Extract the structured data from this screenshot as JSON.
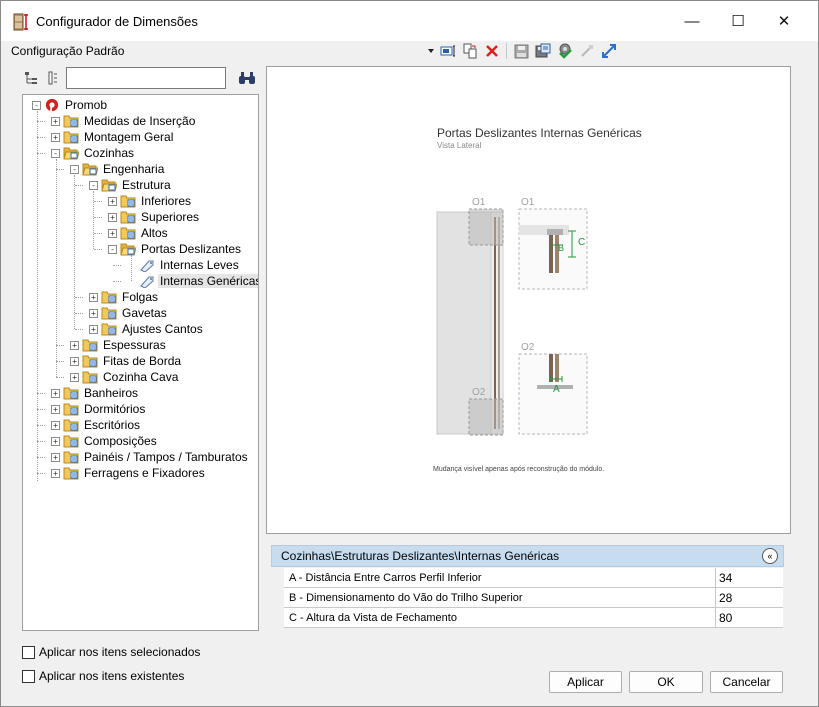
{
  "window": {
    "title": "Configurador de Dimensões",
    "minimize": "—",
    "maximize": "☐",
    "close": "✕"
  },
  "config": {
    "label": "Configuração Padrão"
  },
  "toolbar": {
    "icons": [
      "dropdown-arrow-icon",
      "text-field-icon",
      "copy-icon",
      "delete-icon",
      "save-icon",
      "save-as-icon",
      "settings-check-icon",
      "collapse-icon",
      "expand-icon"
    ]
  },
  "search": {
    "value": "",
    "placeholder": ""
  },
  "tree": {
    "root": "Promob",
    "items": [
      {
        "label": "Medidas de Inserção"
      },
      {
        "label": "Montagem Geral"
      },
      {
        "label": "Cozinhas"
      },
      {
        "label": "Engenharia"
      },
      {
        "label": "Estrutura"
      },
      {
        "label": "Inferiores"
      },
      {
        "label": "Superiores"
      },
      {
        "label": "Altos"
      },
      {
        "label": "Portas Deslizantes"
      },
      {
        "label": "Internas Leves"
      },
      {
        "label": "Internas Genéricas"
      },
      {
        "label": "Folgas"
      },
      {
        "label": "Gavetas"
      },
      {
        "label": "Ajustes Cantos"
      },
      {
        "label": "Espessuras"
      },
      {
        "label": "Fitas de Borda"
      },
      {
        "label": "Cozinha Cava"
      },
      {
        "label": "Banheiros"
      },
      {
        "label": "Dormitórios"
      },
      {
        "label": "Escritórios"
      },
      {
        "label": "Composições"
      },
      {
        "label": "Painéis / Tampos / Tamburatos"
      },
      {
        "label": "Ferragens e Fixadores"
      }
    ]
  },
  "preview": {
    "title": "Portas Deslizantes Internas Genéricas",
    "subtitle": "Vista Lateral",
    "labels": {
      "o1a": "O1",
      "o1b": "O1",
      "o2a": "O2",
      "o2b": "O2",
      "a": "A",
      "b": "B",
      "c": "C"
    },
    "note": "Mudança visível apenas após reconstrução do módulo."
  },
  "properties": {
    "path": "Cozinhas\\Estruturas Deslizantes\\Internas Genéricas",
    "collapse": "«",
    "rows": [
      {
        "name": "A - Distância Entre Carros Perfil Inferior",
        "value": "34"
      },
      {
        "name": "B - Dimensionamento do Vão do Trilho Superior",
        "value": "28"
      },
      {
        "name": "C - Altura da Vista de Fechamento",
        "value": "80"
      }
    ]
  },
  "options": {
    "apply_selected": "Aplicar nos itens selecionados",
    "apply_existing": "Aplicar nos itens existentes"
  },
  "buttons": {
    "apply": "Aplicar",
    "ok": "OK",
    "cancel": "Cancelar"
  }
}
